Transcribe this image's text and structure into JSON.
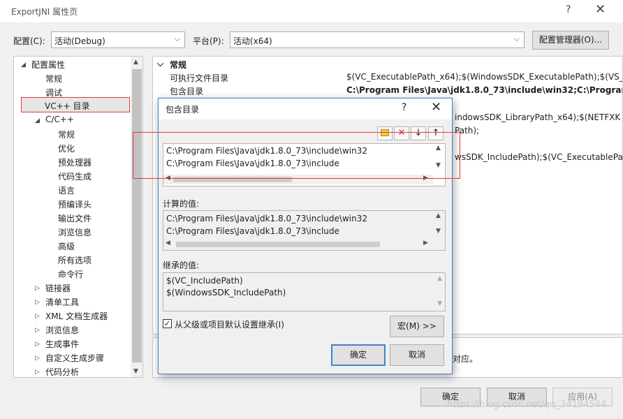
{
  "window": {
    "title": "ExportJNI 属性页",
    "help": "?",
    "close": "✕"
  },
  "toolbar": {
    "config_label": "配置(C):",
    "config_value": "活动(Debug)",
    "platform_label": "平台(P):",
    "platform_value": "活动(x64)",
    "config_manager": "配置管理器(O)..."
  },
  "tree": {
    "items": [
      "配置属性",
      "常规",
      "调试",
      "VC++ 目录",
      "C/C++",
      "常规",
      "优化",
      "预处理器",
      "代码生成",
      "语言",
      "预编译头",
      "输出文件",
      "浏览信息",
      "高级",
      "所有选项",
      "命令行",
      "链接器",
      "清单工具",
      "XML 文档生成器",
      "浏览信息",
      "生成事件",
      "自定义生成步骤",
      "代码分析"
    ]
  },
  "grid": {
    "section": "常规",
    "rows": [
      {
        "name": "可执行文件目录",
        "value": "$(VC_ExecutablePath_x64);$(WindowsSDK_ExecutablePath);$(VS_E"
      },
      {
        "name": "包含目录",
        "value": "C:\\Program Files\\Java\\jdk1.8.0_73\\include\\win32;C:\\Program"
      }
    ],
    "partials": [
      "indowsSDK_LibraryPath_x64);$(NETFXK",
      "Path);",
      "wsSDK_IncludePath);$(VC_ExecutablePa"
    ],
    "desc_tail": "对应。"
  },
  "dialog": {
    "title": "包含目录",
    "help": "?",
    "close": "✕",
    "paths": [
      "C:\\Program Files\\Java\\jdk1.8.0_73\\include\\win32",
      "C:\\Program Files\\Java\\jdk1.8.0_73\\include"
    ],
    "computed_label": "计算的值:",
    "computed": [
      "C:\\Program Files\\Java\\jdk1.8.0_73\\include\\win32",
      "C:\\Program Files\\Java\\jdk1.8.0_73\\include"
    ],
    "inherited_label": "继承的值:",
    "inherited": [
      "$(VC_IncludePath)",
      "$(WindowsSDK_IncludePath)"
    ],
    "inherit_checkbox": "从父级或项目默认设置继承(I)",
    "macro_button": "宏(M) >>",
    "ok": "确定",
    "cancel": "取消"
  },
  "footer": {
    "ok": "确定",
    "cancel": "取消",
    "apply": "应用(A)"
  },
  "watermark": "https://blog.csdn.net/qq_34194544",
  "colors": {
    "highlight_border": "#e03a3a",
    "dialog_border": "#3f84c8",
    "ok_border": "#3f84c8"
  }
}
